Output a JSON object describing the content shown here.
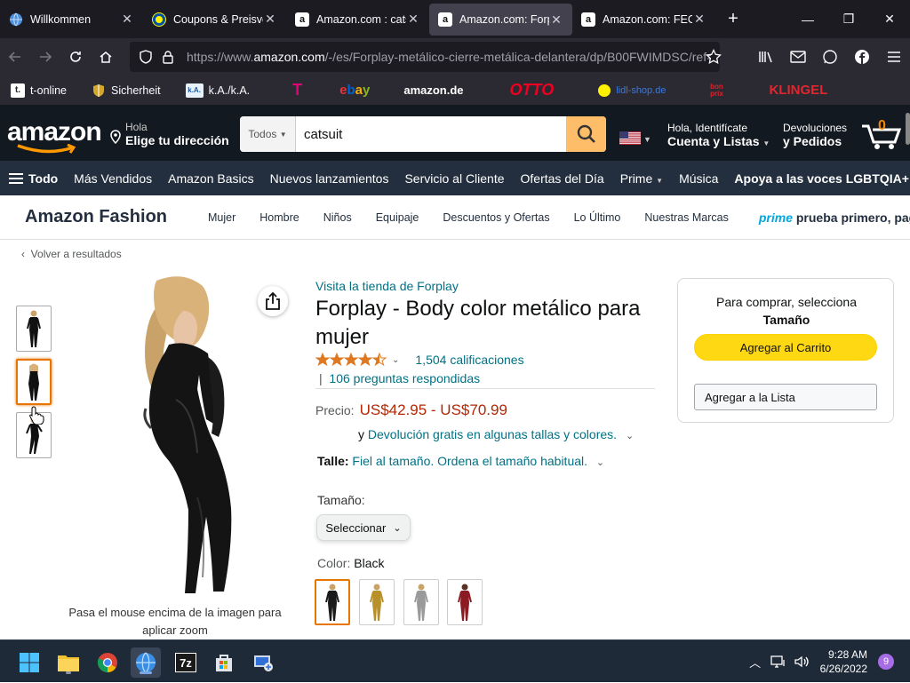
{
  "browser": {
    "tabs": [
      {
        "title": "Willkommen",
        "icon": "globe-icon",
        "active": false
      },
      {
        "title": "Coupons & Preisvo",
        "icon": "lidl-icon",
        "active": false
      },
      {
        "title": "Amazon.com : cats",
        "icon": "amazon-icon",
        "active": false
      },
      {
        "title": "Amazon.com: Forp",
        "icon": "amazon-icon",
        "active": true
      },
      {
        "title": "Amazon.com: FEO",
        "icon": "amazon-icon",
        "active": false
      }
    ],
    "url_prefix": "https://www.",
    "url_host": "amazon.com",
    "url_path": "/-/es/Forplay-metálico-cierre-metálica-delantera/dp/B00FWIMDSC/ref=",
    "bookmarks": [
      {
        "label": "t-online",
        "icon": "tonline-icon"
      },
      {
        "label": "Sicherheit",
        "icon": "shield-icon"
      },
      {
        "label": "k.A./k.A.",
        "icon": "ka-icon"
      },
      {
        "label": "",
        "icon": "telekom-icon"
      },
      {
        "label": "ebay",
        "icon": "ebay-logo"
      },
      {
        "label": "amazon.de",
        "icon": "amazon-de-logo"
      },
      {
        "label": "OTTO",
        "icon": "otto-logo"
      },
      {
        "label": "lidl-shop.de",
        "icon": "lidl-shop-logo"
      },
      {
        "label": "bon prix",
        "icon": "bonprix-logo"
      },
      {
        "label": "KLINGEL",
        "icon": "klingel-logo"
      }
    ]
  },
  "amazon": {
    "deliver_line1": "Hola",
    "deliver_line2": "Elige tu dirección",
    "search_category": "Todos",
    "search_value": "catsuit",
    "account_line1": "Hola, Identifícate",
    "account_line2": "Cuenta y Listas",
    "returns_line1": "Devoluciones",
    "returns_line2": "y Pedidos",
    "cart_count": "0",
    "nav_all": "Todo",
    "nav_items": [
      "Más Vendidos",
      "Amazon Basics",
      "Nuevos lanzamientos",
      "Servicio al Cliente",
      "Ofertas del Día",
      "Prime",
      "Música"
    ],
    "nav_pride": "Apoya a las voces LGBTQIA+",
    "fashion_brand": "Amazon Fashion",
    "fashion_items": [
      "Mujer",
      "Hombre",
      "Niños",
      "Equipaje",
      "Descuentos y Ofertas",
      "Lo Último",
      "Nuestras Marcas"
    ],
    "prime_word": "prime",
    "prime_text": "prueba primero, paga d"
  },
  "product": {
    "back_link": "Volver a resultados",
    "store_link": "Visita la tienda de Forplay",
    "title": "Forplay - Body color metálico para mujer",
    "rating_stars": 4.5,
    "ratings_count": "1,504 calificaciones",
    "answers": "106 preguntas respondidas",
    "price_label": "Precio:",
    "price_value": "US$42.95 - US$70.99",
    "returns_prefix": "y ",
    "returns_link": "Devolución gratis en algunas tallas y colores.",
    "size_label": "Talle:",
    "size_text": "Fiel al tamaño. Ordena el tamaño habitual.",
    "tamano_label": "Tamaño:",
    "select_value": "Seleccionar",
    "color_label": "Color:",
    "color_value": "Black",
    "swatches": [
      {
        "name": "Black",
        "color": "#1a1a1a"
      },
      {
        "name": "Gold",
        "color": "#b8902a"
      },
      {
        "name": "Silver",
        "color": "#9a9a9a"
      },
      {
        "name": "Red",
        "color": "#8b1a22"
      }
    ],
    "zoom_hint": "Pasa el mouse encima de la imagen para aplicar zoom"
  },
  "buybox": {
    "msg_line1": "Para comprar, selecciona",
    "msg_line2": "Tamaño",
    "add_to_cart": "Agregar al Carrito",
    "add_to_list": "Agregar a la Lista"
  },
  "taskbar": {
    "time": "9:28 AM",
    "date": "6/26/2022",
    "notifications": "9"
  },
  "colors": {
    "amazon_dark": "#131921",
    "amazon_nav": "#232f3e",
    "search_button": "#febd69",
    "price_red": "#b12704",
    "link_teal": "#007185",
    "cart_yellow": "#ffd814",
    "selected_orange": "#e77600"
  }
}
